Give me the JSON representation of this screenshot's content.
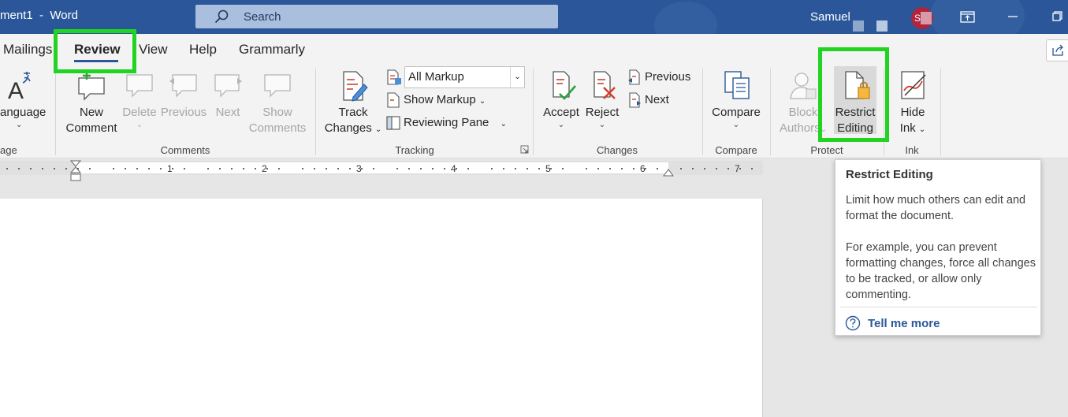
{
  "app": {
    "doc_title": "ment1  -  Word",
    "search_placeholder": "Search",
    "user_name": "Samuel",
    "avatar_initials": "SI"
  },
  "tabs": [
    {
      "label": "Mailings"
    },
    {
      "label": "Review",
      "active": true
    },
    {
      "label": "View"
    },
    {
      "label": "Help"
    },
    {
      "label": "Grammarly"
    }
  ],
  "ribbon": {
    "language": {
      "label": "anguage",
      "group": "age"
    },
    "comments": {
      "new_line1": "New",
      "new_line2": "Comment",
      "delete": "Delete",
      "previous": "Previous",
      "next": "Next",
      "show_line1": "Show",
      "show_line2": "Comments",
      "group": "Comments"
    },
    "tracking": {
      "track_line1": "Track",
      "track_line2": "Changes",
      "markup_value": "All Markup",
      "show_markup": "Show Markup",
      "reviewing_pane": "Reviewing Pane",
      "group": "Tracking"
    },
    "changes": {
      "accept": "Accept",
      "reject": "Reject",
      "previous": "Previous",
      "next": "Next",
      "group": "Changes"
    },
    "compare": {
      "label": "Compare",
      "group": "Compare"
    },
    "protect": {
      "block_line1": "Block",
      "block_line2": "Authors",
      "restrict_line1": "Restrict",
      "restrict_line2": "Editing",
      "group": "Protect"
    },
    "ink": {
      "hide_line1": "Hide",
      "hide_line2": "Ink",
      "group": "Ink"
    }
  },
  "ruler": {
    "numbers": [
      "1",
      "2",
      "3",
      "4",
      "5",
      "6",
      "7"
    ]
  },
  "tooltip": {
    "title": "Restrict Editing",
    "para1": "Limit how much others can edit and format the document.",
    "para2": "For example, you can prevent formatting changes, force all changes to be tracked, or allow only commenting.",
    "link": "Tell me more"
  },
  "colors": {
    "titlebar": "#2b579a",
    "highlight": "#21d421",
    "link": "#2b579a",
    "ribbon_bg": "#f3f3f3"
  }
}
